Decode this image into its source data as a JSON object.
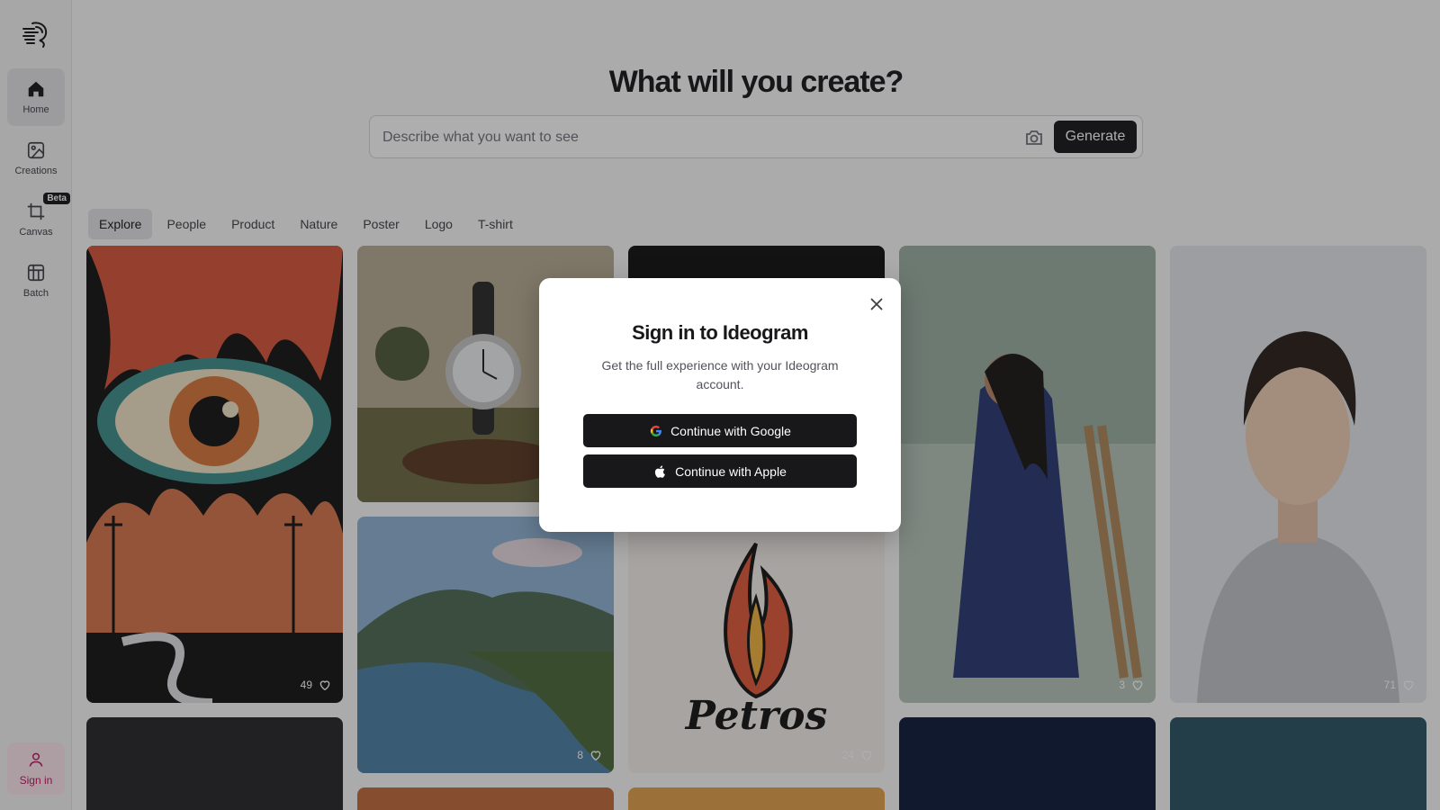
{
  "sidebar": {
    "items": [
      {
        "label": "Home",
        "icon": "home-icon"
      },
      {
        "label": "Creations",
        "icon": "image-icon"
      },
      {
        "label": "Canvas",
        "icon": "canvas-icon",
        "badge": "Beta"
      },
      {
        "label": "Batch",
        "icon": "batch-icon"
      }
    ],
    "signin_label": "Sign in"
  },
  "main": {
    "headline": "What will you create?",
    "prompt_placeholder": "Describe what you want to see",
    "generate_label": "Generate",
    "tabs": [
      "Explore",
      "People",
      "Product",
      "Nature",
      "Poster",
      "Logo",
      "T-shirt"
    ]
  },
  "gallery": {
    "likes": [
      "49",
      "8",
      "24",
      "3",
      "71"
    ],
    "logo_text": "Petros"
  },
  "modal": {
    "title": "Sign in to Ideogram",
    "subtitle": "Get the full experience with your Ideogram account.",
    "google_label": "Continue with Google",
    "apple_label": "Continue with Apple"
  },
  "colors": {
    "accent": "#18181b",
    "signin": "#be185d"
  }
}
